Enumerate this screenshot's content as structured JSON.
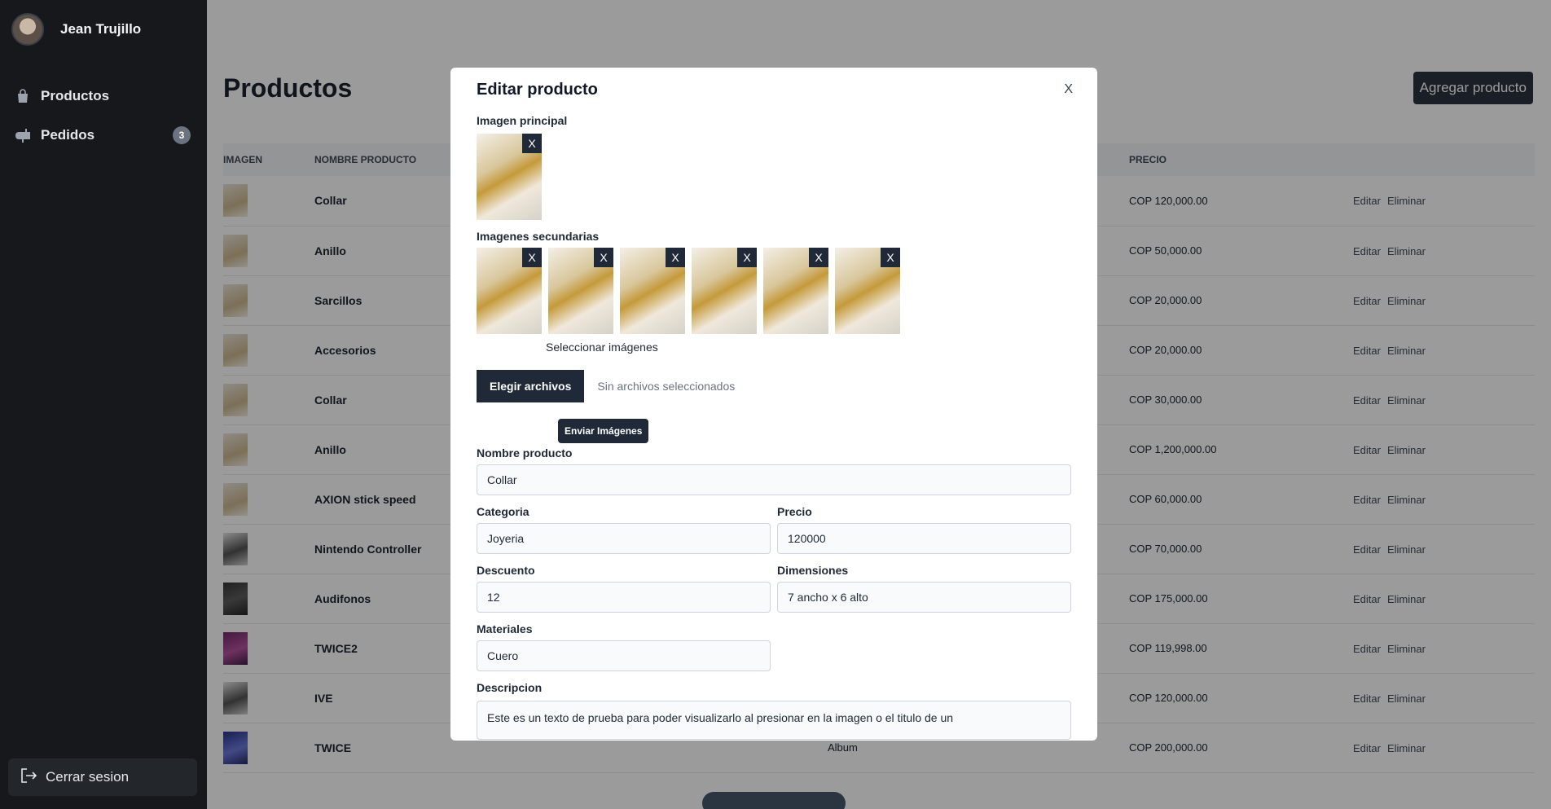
{
  "sidebar": {
    "user_name": "Jean Trujillo",
    "items": [
      {
        "label": "Productos",
        "icon": "shopping-bag-icon"
      },
      {
        "label": "Pedidos",
        "icon": "mailbox-icon",
        "badge": "3"
      }
    ],
    "logout_label": "Cerrar sesion"
  },
  "main": {
    "title": "Productos",
    "add_button": "Agregar producto",
    "columns": [
      "IMAGEN",
      "NOMBRE PRODUCTO",
      "",
      "PRECIO",
      ""
    ],
    "rows": [
      {
        "name": "Collar",
        "category": "",
        "price": "COP 120,000.00",
        "thumb": "gold"
      },
      {
        "name": "Anillo",
        "category": "",
        "price": "COP 50,000.00",
        "thumb": "gold"
      },
      {
        "name": "Sarcillos",
        "category": "",
        "price": "COP 20,000.00",
        "thumb": "gold"
      },
      {
        "name": "Accesorios",
        "category": "",
        "price": "COP 20,000.00",
        "thumb": "gold"
      },
      {
        "name": "Collar",
        "category": "",
        "price": "COP 30,000.00",
        "thumb": "gold"
      },
      {
        "name": "Anillo",
        "category": "",
        "price": "COP 1,200,000.00",
        "thumb": "gold"
      },
      {
        "name": "AXION stick speed",
        "category": "",
        "price": "COP 60,000.00",
        "thumb": "gold"
      },
      {
        "name": "Nintendo Controller",
        "category": "",
        "price": "COP 70,000.00",
        "thumb": "person"
      },
      {
        "name": "Audifonos",
        "category": "",
        "price": "COP 175,000.00",
        "thumb": "dark"
      },
      {
        "name": "TWICE2",
        "category": "",
        "price": "COP 119,998.00",
        "thumb": "purple"
      },
      {
        "name": "IVE",
        "category": "",
        "price": "COP 120,000.00",
        "thumb": "person"
      },
      {
        "name": "TWICE",
        "category": "Album",
        "price": "COP 200,000.00",
        "thumb": "blue"
      }
    ],
    "edit_label": "Editar",
    "delete_label": "Eliminar"
  },
  "modal": {
    "title": "Editar producto",
    "close_label": "X",
    "main_image_label": "Imagen principal",
    "secondary_images_label": "Imagenes secundarias",
    "remove_label": "X",
    "secondary_count": 6,
    "select_images_label": "Seleccionar imágenes",
    "choose_files_label": "Elegir archivos",
    "no_files_label": "Sin archivos seleccionados",
    "send_images_label": "Enviar Imágenes",
    "fields": {
      "name_label": "Nombre producto",
      "name_value": "Collar",
      "category_label": "Categoria",
      "category_value": "Joyeria",
      "price_label": "Precio",
      "price_value": "120000",
      "discount_label": "Descuento",
      "discount_value": "12",
      "dimensions_label": "Dimensiones",
      "dimensions_value": "7 ancho x 6 alto",
      "materials_label": "Materiales",
      "materials_value": "Cuero",
      "description_label": "Descripcion",
      "description_value": "Este es un texto de prueba para poder visualizarlo al presionar en la imagen o el titulo de un"
    }
  }
}
